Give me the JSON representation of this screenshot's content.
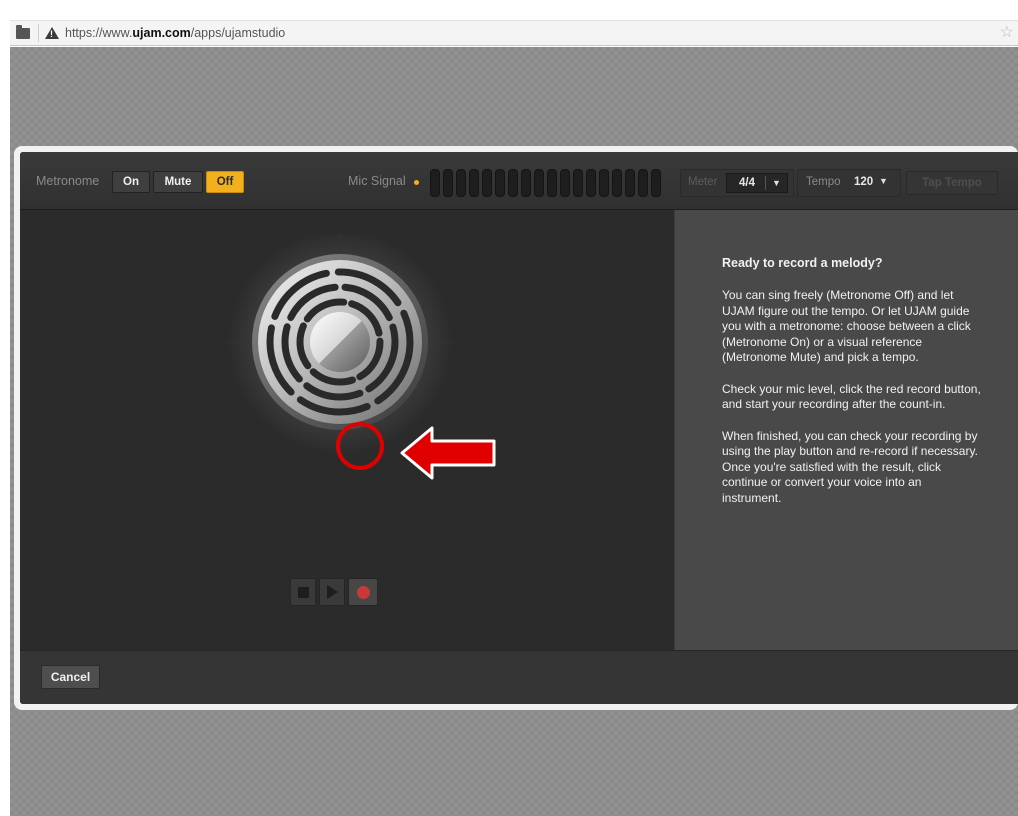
{
  "browser": {
    "url_prefix": "https://www.",
    "url_domain": "ujam.com",
    "url_path": "/apps/ujamstudio",
    "icons": [
      "folder-icon",
      "security-warning-icon",
      "bookmark-star-icon"
    ]
  },
  "toolbar": {
    "metronome_label": "Metronome",
    "metronome_options": [
      "On",
      "Mute",
      "Off"
    ],
    "metronome_selected": "Off",
    "mic_signal_label": "Mic Signal",
    "meter_label": "Meter",
    "meter_value": "4/4",
    "tempo_label": "Tempo",
    "tempo_value": "120",
    "tap_tempo_label": "Tap Tempo",
    "accent_color": "#f2b11c"
  },
  "transport": {
    "buttons": [
      "stop-button",
      "play-button",
      "record-button"
    ],
    "record_color": "#c83a3a",
    "highlight_color": "#e10000"
  },
  "info": {
    "title": "Ready to record a melody?",
    "paragraphs": [
      "You can sing freely (Metronome Off) and let UJAM figure out the tempo. Or let UJAM guide you with a metronome: choose between a click (Metronome On) or a visual reference (Metronome Mute) and pick a tempo.",
      "Check your mic level, click the red record button, and start your recording after the count-in.",
      "When finished, you can check your recording by using the play button and re-record if necessary. Once you're satisfied with the result, click continue or convert your voice into an instrument."
    ]
  },
  "footer": {
    "cancel_label": "Cancel"
  }
}
